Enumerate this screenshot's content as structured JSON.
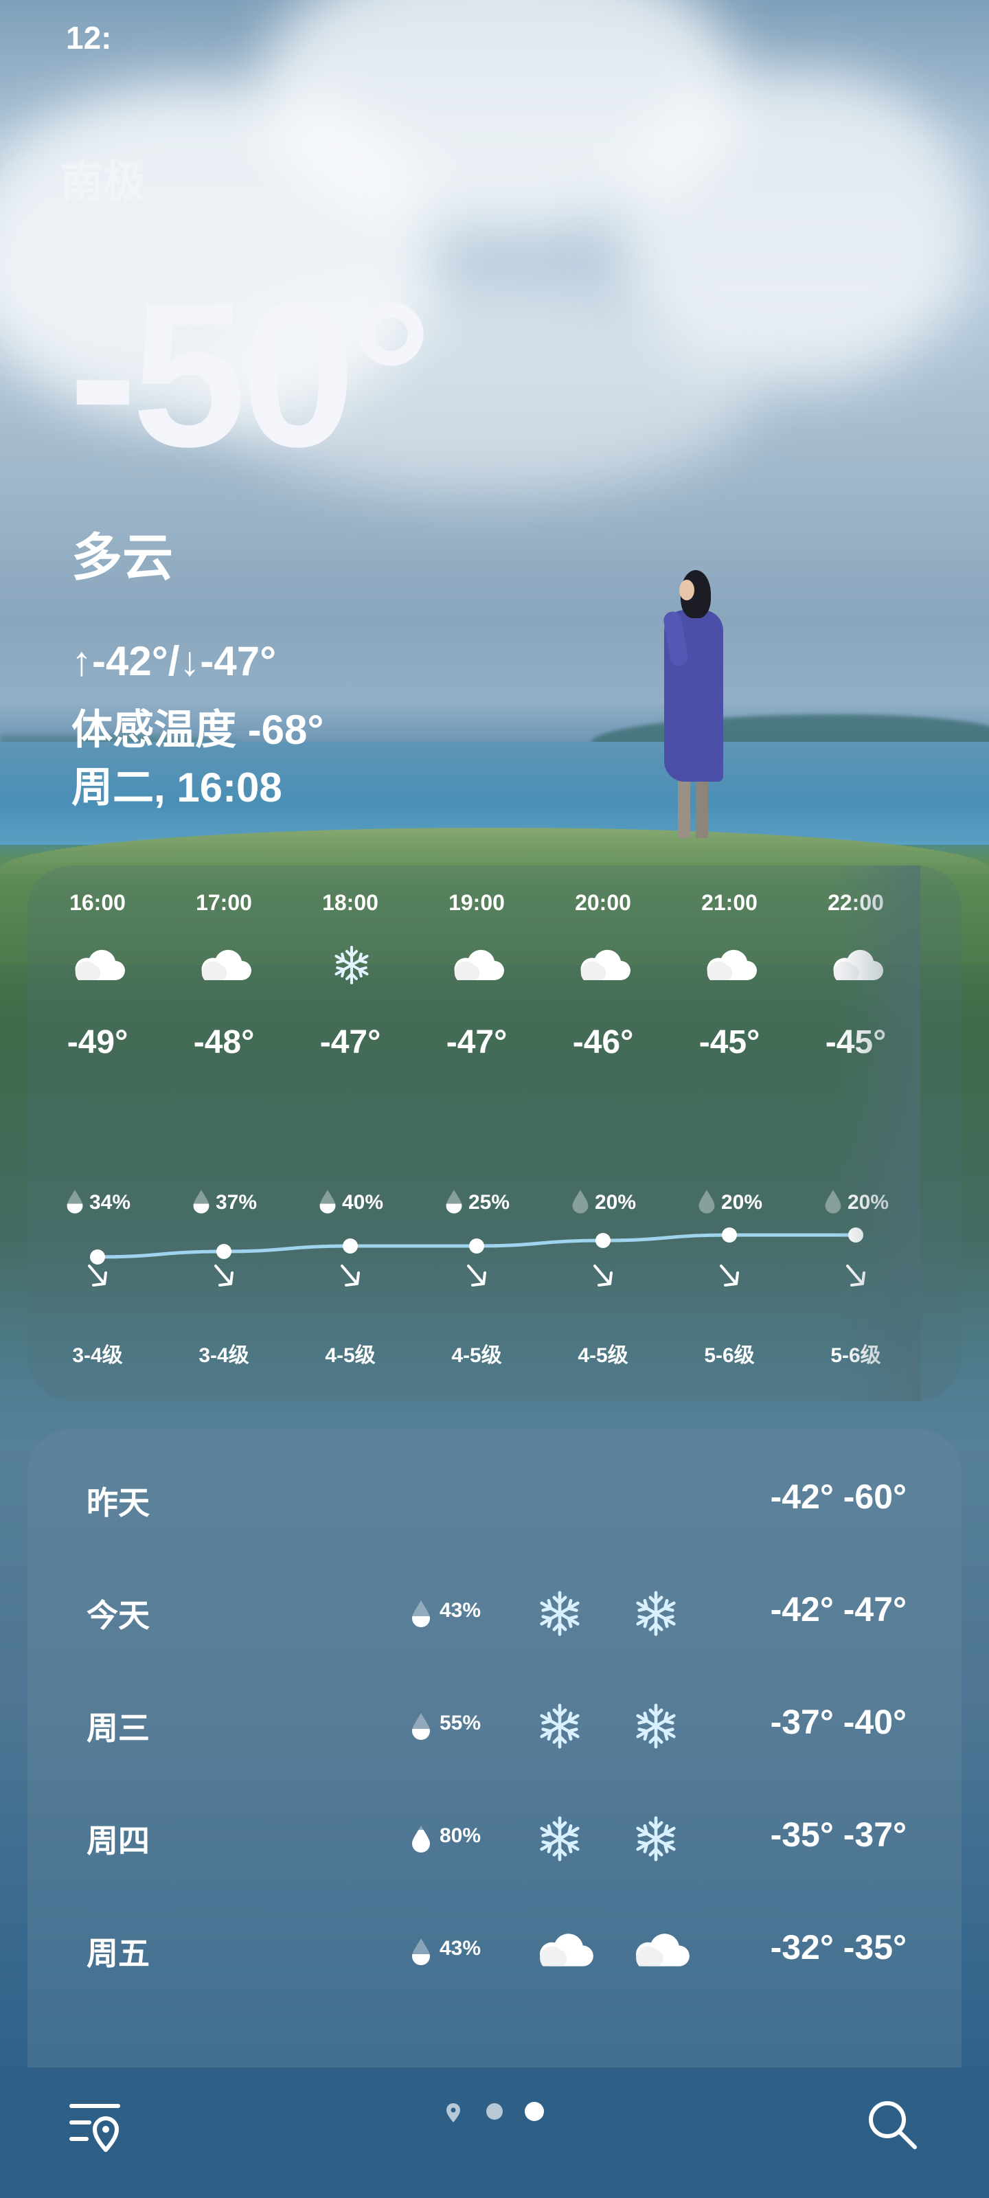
{
  "status_bar": {
    "time": "12:"
  },
  "location": "南极",
  "current": {
    "temperature": "-50°",
    "condition": "多云",
    "high_low": "↑-42°/↓-47°",
    "feels_like": "体感温度 -68°",
    "datetime": "周二, 16:08"
  },
  "hourly": [
    {
      "time": "16:00",
      "icon": "cloud-icon",
      "temp": "-49°",
      "temp_value": -49,
      "precip": "34%",
      "precip_level": 0.5,
      "wind": "3-4级"
    },
    {
      "time": "17:00",
      "icon": "cloud-icon",
      "temp": "-48°",
      "temp_value": -48,
      "precip": "37%",
      "precip_level": 0.5,
      "wind": "3-4级"
    },
    {
      "time": "18:00",
      "icon": "snow-icon",
      "temp": "-47°",
      "temp_value": -47,
      "precip": "40%",
      "precip_level": 0.5,
      "wind": "4-5级"
    },
    {
      "time": "19:00",
      "icon": "cloud-icon",
      "temp": "-47°",
      "temp_value": -47,
      "precip": "25%",
      "precip_level": 0.5,
      "wind": "4-5级"
    },
    {
      "time": "20:00",
      "icon": "cloud-icon",
      "temp": "-46°",
      "temp_value": -46,
      "precip": "20%",
      "precip_level": 0,
      "wind": "4-5级"
    },
    {
      "time": "21:00",
      "icon": "cloud-icon",
      "temp": "-45°",
      "temp_value": -45,
      "precip": "20%",
      "precip_level": 0,
      "wind": "5-6级"
    },
    {
      "time": "22:00",
      "icon": "cloud-icon",
      "temp": "-45°",
      "temp_value": -45,
      "precip": "20%",
      "precip_level": 0,
      "wind": "5-6级"
    }
  ],
  "daily": [
    {
      "day": "昨天",
      "precip": "",
      "icon_day": "",
      "icon_night": "",
      "temps": "-42° -60°"
    },
    {
      "day": "今天",
      "precip": "43%",
      "precip_level": 0.5,
      "icon_day": "snow-icon",
      "icon_night": "snow-icon",
      "temps": "-42° -47°"
    },
    {
      "day": "周三",
      "precip": "55%",
      "precip_level": 0.5,
      "icon_day": "snow-icon",
      "icon_night": "snow-icon",
      "temps": "-37° -40°"
    },
    {
      "day": "周四",
      "precip": "80%",
      "precip_level": 1,
      "icon_day": "snow-icon",
      "icon_night": "snow-icon",
      "temps": "-35° -37°"
    },
    {
      "day": "周五",
      "precip": "43%",
      "precip_level": 0.5,
      "icon_day": "cloud-icon",
      "icon_night": "cloud-icon",
      "temps": "-32° -35°"
    }
  ],
  "nav": {
    "menu_icon": "location-list-icon",
    "search_icon": "search-icon",
    "pages": 3,
    "active_page": 3
  },
  "colors": {
    "curve": "#9fd3ee",
    "snow": "#d9f1ff",
    "nav_bg": "#2e5f86"
  }
}
